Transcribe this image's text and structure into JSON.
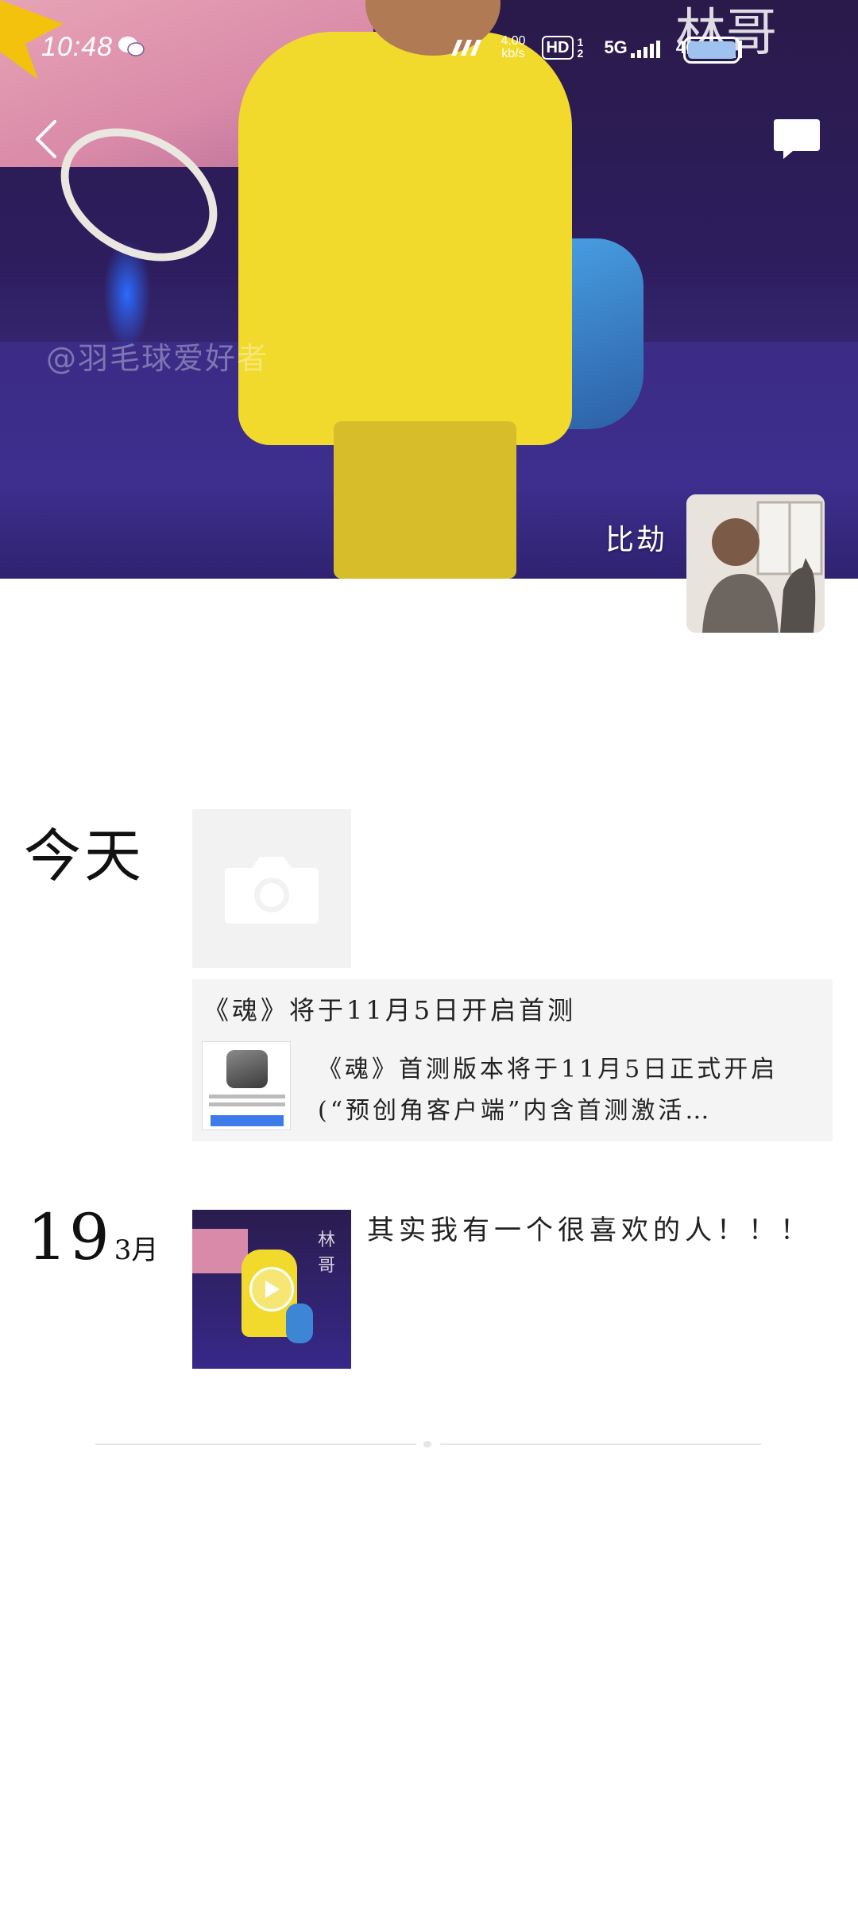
{
  "status_bar": {
    "time": "10:48",
    "net_speed_value": "4.00",
    "net_speed_unit": "kb/s",
    "hd_label": "HD",
    "hd_sub": "1 2",
    "signal_1": "5G",
    "signal_2": "4G+",
    "icons": [
      "wechat-icon",
      "vpn-icon",
      "signal-icon",
      "battery-icon"
    ]
  },
  "cover": {
    "watermark": "@羽毛球爱好者",
    "corner_text": "林哥"
  },
  "header": {
    "back_icon": "chevron-left-icon",
    "comment_icon": "comment-icon"
  },
  "profile": {
    "nickname": "比劫"
  },
  "feed": {
    "today": {
      "date_label": "今天",
      "placeholder_icon": "camera-icon",
      "share": {
        "title": "《魂》将于11月5日开启首测",
        "description": "《魂》首测版本将于11月5日正式开启(“预创角客户端”内含首测激活…"
      }
    },
    "past": {
      "day": "19",
      "month": "3月",
      "post_text": "其实我有一个很喜欢的人！！！",
      "thumb_glyph": "林哥"
    }
  },
  "colors": {
    "cover_bg": "#2d1d5e",
    "jersey": "#f1da2c",
    "card_bg": "#f4f4f4",
    "divider": "#e6e6e6"
  }
}
